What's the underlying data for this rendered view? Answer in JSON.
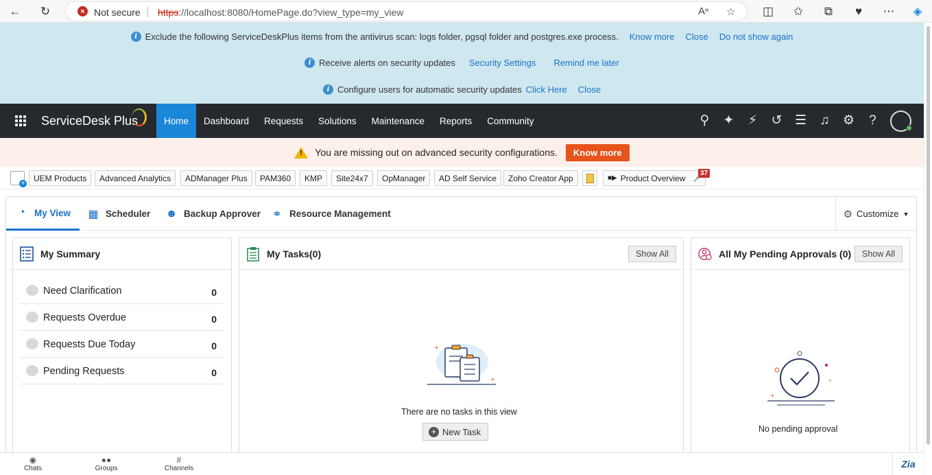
{
  "browser": {
    "not_secure": "Not secure",
    "url_proto": "https",
    "url_rest": "://localhost:8080/HomePage.do?view_type=my_view"
  },
  "notices": {
    "row1_text": "Exclude the following ServiceDeskPlus items from the antivirus scan: logs folder, pgsql folder and postgres.exe process.",
    "row1_know_more": "Know more",
    "row1_close": "Close",
    "row1_do_not_show": "Do not show again",
    "row2_text": "Receive alerts on security updates",
    "row2_security_settings": "Security Settings",
    "row2_remind": "Remind me later",
    "row3_text": "Configure users for automatic security updates",
    "row3_click_here": "Click Here",
    "row3_close": "Close"
  },
  "nav": {
    "brand": "ServiceDesk Plus",
    "items": [
      "Home",
      "Dashboard",
      "Requests",
      "Solutions",
      "Maintenance",
      "Reports",
      "Community"
    ]
  },
  "security_banner": {
    "text": "You are missing out on advanced security configurations.",
    "button": "Know more"
  },
  "quick_links": {
    "items": [
      "UEM Products",
      "Advanced Analytics",
      "ADManager Plus",
      "PAM360",
      "KMP",
      "Site24x7",
      "OpManager",
      "AD Self Service",
      "Zoho Creator App"
    ],
    "product_overview": "Product Overview",
    "badge": "37"
  },
  "tabs": {
    "items": [
      "My View",
      "Scheduler",
      "Backup Approver",
      "Resource Management"
    ],
    "customize": "Customize"
  },
  "summary": {
    "title": "My Summary",
    "rows": [
      {
        "label": "Need Clarification",
        "count": "0"
      },
      {
        "label": "Requests Overdue",
        "count": "0"
      },
      {
        "label": "Requests Due Today",
        "count": "0"
      },
      {
        "label": "Pending Requests",
        "count": "0"
      }
    ]
  },
  "tasks": {
    "title": "My Tasks(0)",
    "show_all": "Show All",
    "empty": "There are no tasks in this view",
    "new_task": "New Task"
  },
  "approvals": {
    "title": "All My Pending Approvals (0)",
    "show_all": "Show All",
    "empty": "No pending approval"
  },
  "chatbar": {
    "chats": "Chats",
    "groups": "Groups",
    "channels": "Channels"
  },
  "colors": {
    "nav_bg": "#262a2f",
    "accent": "#1a87d8",
    "notice_bg": "#cfe7ef",
    "warning_button": "#e8531b"
  }
}
